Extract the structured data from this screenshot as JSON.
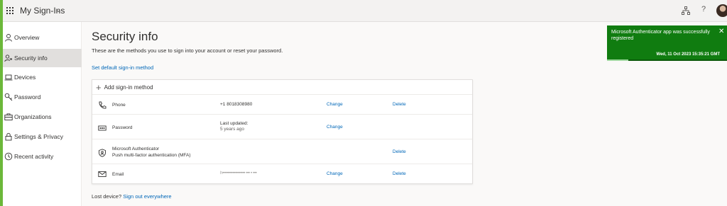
{
  "header": {
    "app_title": "My Sign-Ins",
    "icons": [
      "app-launcher-icon",
      "org-icon",
      "help-icon",
      "avatar"
    ],
    "help_glyph": "?"
  },
  "sidebar": {
    "items": [
      {
        "label": "Overview",
        "icon": "person-icon",
        "active": false
      },
      {
        "label": "Security info",
        "icon": "security-info-icon",
        "active": true
      },
      {
        "label": "Devices",
        "icon": "laptop-icon",
        "active": false
      },
      {
        "label": "Password",
        "icon": "key-icon",
        "active": false
      },
      {
        "label": "Organizations",
        "icon": "briefcase-icon",
        "active": false
      },
      {
        "label": "Settings & Privacy",
        "icon": "lock-icon",
        "active": false
      },
      {
        "label": "Recent activity",
        "icon": "history-icon",
        "active": false
      }
    ]
  },
  "main": {
    "title": "Security info",
    "description": "These are the methods you use to sign into your account or reset your password.",
    "default_method_link": "Set default sign-in method",
    "add_method_label": "Add sign-in method",
    "methods": [
      {
        "icon": "phone-icon",
        "name": "Phone",
        "detail": "+1 8018308980",
        "detail_sub": "",
        "change": "Change",
        "delete": "Delete"
      },
      {
        "icon": "password-icon",
        "name": "Password",
        "detail": "Last updated:",
        "detail_sub": "5 years ago",
        "change": "Change",
        "delete": ""
      },
      {
        "icon": "authenticator-icon",
        "name": "Microsoft Authenticator",
        "name_sub": "Push multi-factor authentication (MFA)",
        "detail": "",
        "detail_sub": "",
        "change": "",
        "delete": "Delete"
      },
      {
        "icon": "email-icon",
        "name": "Email",
        "detail": "h•••••••••••••••••• ••• • •••",
        "detail_sub": "",
        "change": "Change",
        "delete": "Delete"
      }
    ],
    "lost_device_text": "Lost device?",
    "sign_out_link": "Sign out everywhere"
  },
  "toast": {
    "message": "Microsoft Authenticator app was successfully registered",
    "timestamp": "Wed, 11 Oct 2023 15:35:21 GMT",
    "close_glyph": "✕",
    "progress": 0.18
  },
  "colors": {
    "accent": "#0067b8",
    "toast_bg": "#107c10",
    "left_accent": "#6bb83a"
  }
}
